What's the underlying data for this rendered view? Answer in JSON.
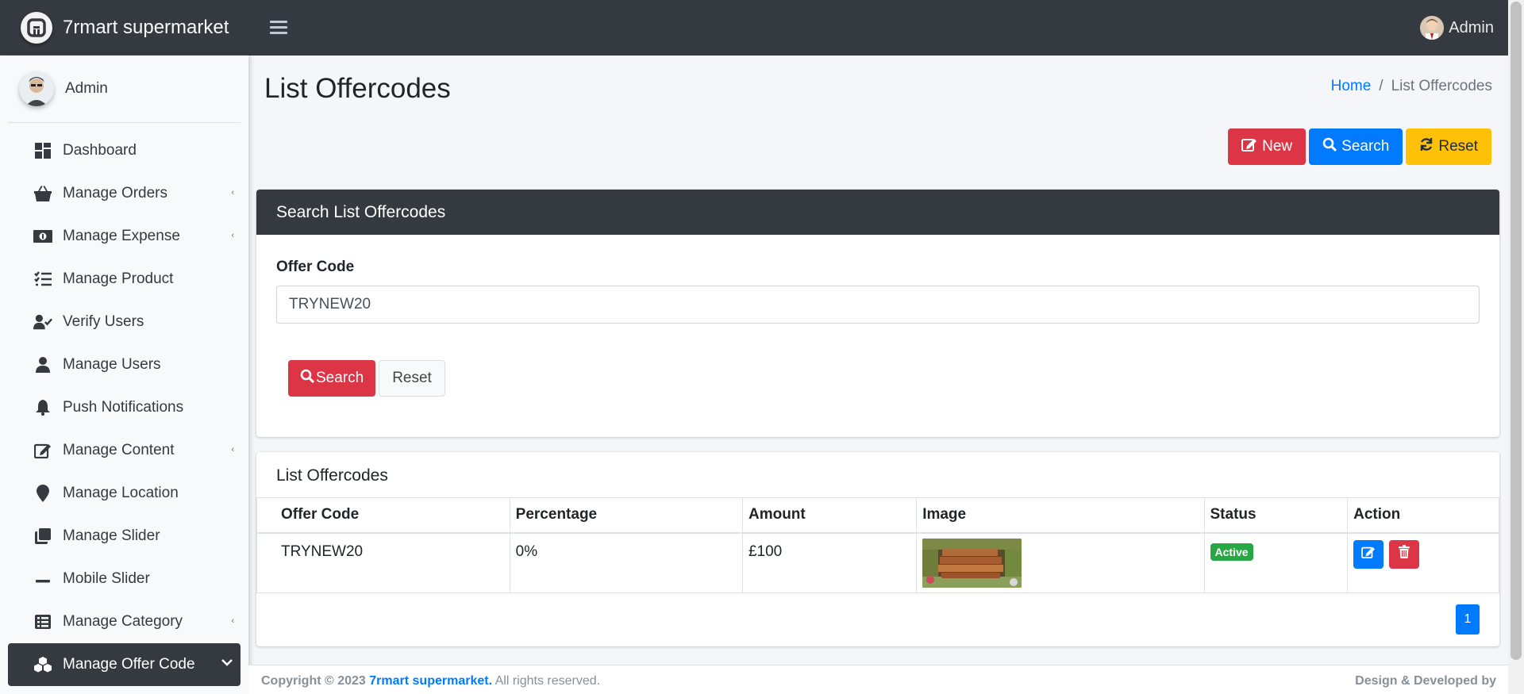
{
  "brand": {
    "name": "7rmart supermarket"
  },
  "topbar": {
    "user_name": "Admin"
  },
  "sidebar": {
    "user_name": "Admin",
    "items": [
      {
        "label": "Dashboard",
        "icon": "dashboard-icon",
        "has_caret": false
      },
      {
        "label": "Manage Orders",
        "icon": "basket-icon",
        "has_caret": true
      },
      {
        "label": "Manage Expense",
        "icon": "money-bill-icon",
        "has_caret": true
      },
      {
        "label": "Manage Product",
        "icon": "tasks-icon",
        "has_caret": false
      },
      {
        "label": "Verify Users",
        "icon": "user-check-icon",
        "has_caret": false
      },
      {
        "label": "Manage Users",
        "icon": "user-icon",
        "has_caret": false
      },
      {
        "label": "Push Notifications",
        "icon": "bell-icon",
        "has_caret": false
      },
      {
        "label": "Manage Content",
        "icon": "edit-icon",
        "has_caret": true
      },
      {
        "label": "Manage Location",
        "icon": "map-marker-icon",
        "has_caret": false
      },
      {
        "label": "Manage Slider",
        "icon": "clone-icon",
        "has_caret": false
      },
      {
        "label": "Mobile Slider",
        "icon": "minus-icon",
        "has_caret": false
      },
      {
        "label": "Manage Category",
        "icon": "list-icon",
        "has_caret": true
      },
      {
        "label": "Manage Offer Code",
        "icon": "cubes-icon",
        "has_caret": true,
        "active": true
      }
    ]
  },
  "page": {
    "title": "List Offercodes",
    "breadcrumb": {
      "home": "Home",
      "separator": "/",
      "current": "List Offercodes"
    }
  },
  "actions": {
    "new_label": "New",
    "search_label": "Search",
    "reset_label": "Reset"
  },
  "search_card": {
    "title": "Search List Offercodes",
    "field_label": "Offer Code",
    "field_value": "TRYNEW20",
    "search_label": "Search",
    "reset_label": "Reset"
  },
  "list_card": {
    "title": "List Offercodes",
    "columns": [
      "Offer Code",
      "Percentage",
      "Amount",
      "Image",
      "Status",
      "Action"
    ],
    "rows": [
      {
        "offer_code": "TRYNEW20",
        "percentage": "0%",
        "amount": "£100",
        "status": "Active"
      }
    ],
    "pagination": {
      "current_page": "1"
    }
  },
  "footer": {
    "copyright_prefix": "Copyright © 2023",
    "company": "7rmart supermarket.",
    "rights": "All rights reserved.",
    "credit": "Design & Developed by"
  },
  "colors": {
    "dark": "#343a40",
    "primary": "#007bff",
    "danger": "#dc3545",
    "warning": "#ffc107",
    "success": "#28a745"
  }
}
